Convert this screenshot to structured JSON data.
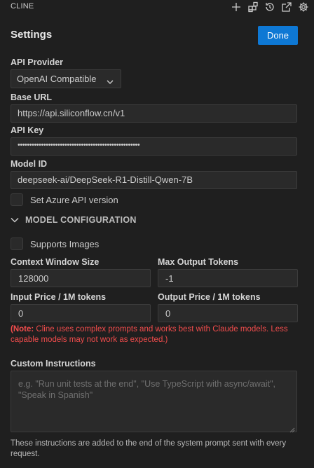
{
  "app": {
    "title": "CLINE"
  },
  "toolbar": {
    "icons": [
      "plus-icon",
      "mcp-servers-icon",
      "history-icon",
      "popout-icon",
      "gear-icon"
    ]
  },
  "settings": {
    "title": "Settings",
    "done_label": "Done"
  },
  "api": {
    "provider_label": "API Provider",
    "provider_value": "OpenAI Compatible",
    "base_url_label": "Base URL",
    "base_url_value": "https://api.siliconflow.cn/v1",
    "api_key_label": "API Key",
    "api_key_value": "••••••••••••••••••••••••••••••••••••••••••••••••••••",
    "model_id_label": "Model ID",
    "model_id_value": "deepseek-ai/DeepSeek-R1-Distill-Qwen-7B",
    "azure_label": "Set Azure API version"
  },
  "model_config": {
    "section_label": "MODEL CONFIGURATION",
    "supports_images_label": "Supports Images",
    "context_window_label": "Context Window Size",
    "context_window_value": "128000",
    "max_output_label": "Max Output Tokens",
    "max_output_value": "-1",
    "input_price_label": "Input Price / 1M tokens",
    "input_price_value": "0",
    "output_price_label": "Output Price / 1M tokens",
    "output_price_value": "0",
    "note_prefix": "(Note:",
    "note_text": " Cline uses complex prompts and works best with Claude models. Less capable models may not work as expected.)"
  },
  "custom_instructions": {
    "label": "Custom Instructions",
    "placeholder": "e.g. \"Run unit tests at the end\", \"Use TypeScript with async/await\", \"Speak in Spanish\"",
    "help_text": "These instructions are added to the end of the system prompt sent with every request."
  },
  "colors": {
    "background": "#1f1f1f",
    "accent": "#0e78d4",
    "warning": "#f14c4c"
  }
}
